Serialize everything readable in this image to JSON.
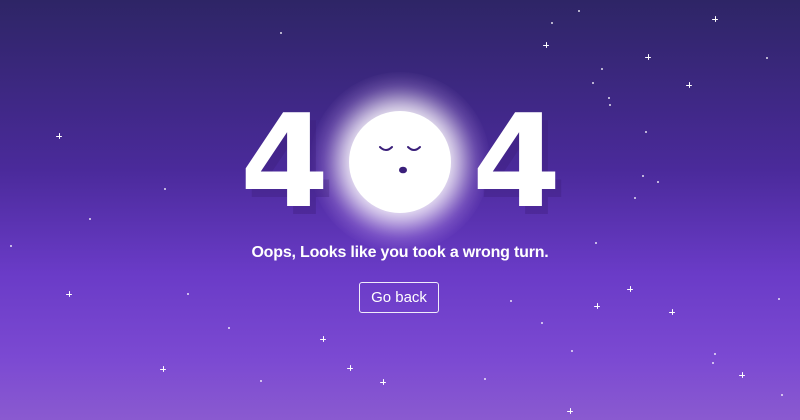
{
  "error": {
    "code_left": "4",
    "code_right": "4",
    "message": "Oops, Looks like you took a wrong turn."
  },
  "actions": {
    "go_back_label": "Go back"
  },
  "illustration": {
    "center_icon": "sleeping-moon-icon",
    "decoration": "starfield"
  },
  "colors": {
    "background_top": "#2e2566",
    "background_bottom": "#8a5ad0",
    "foreground": "#ffffff",
    "moon_face": "#3a1f7a"
  }
}
